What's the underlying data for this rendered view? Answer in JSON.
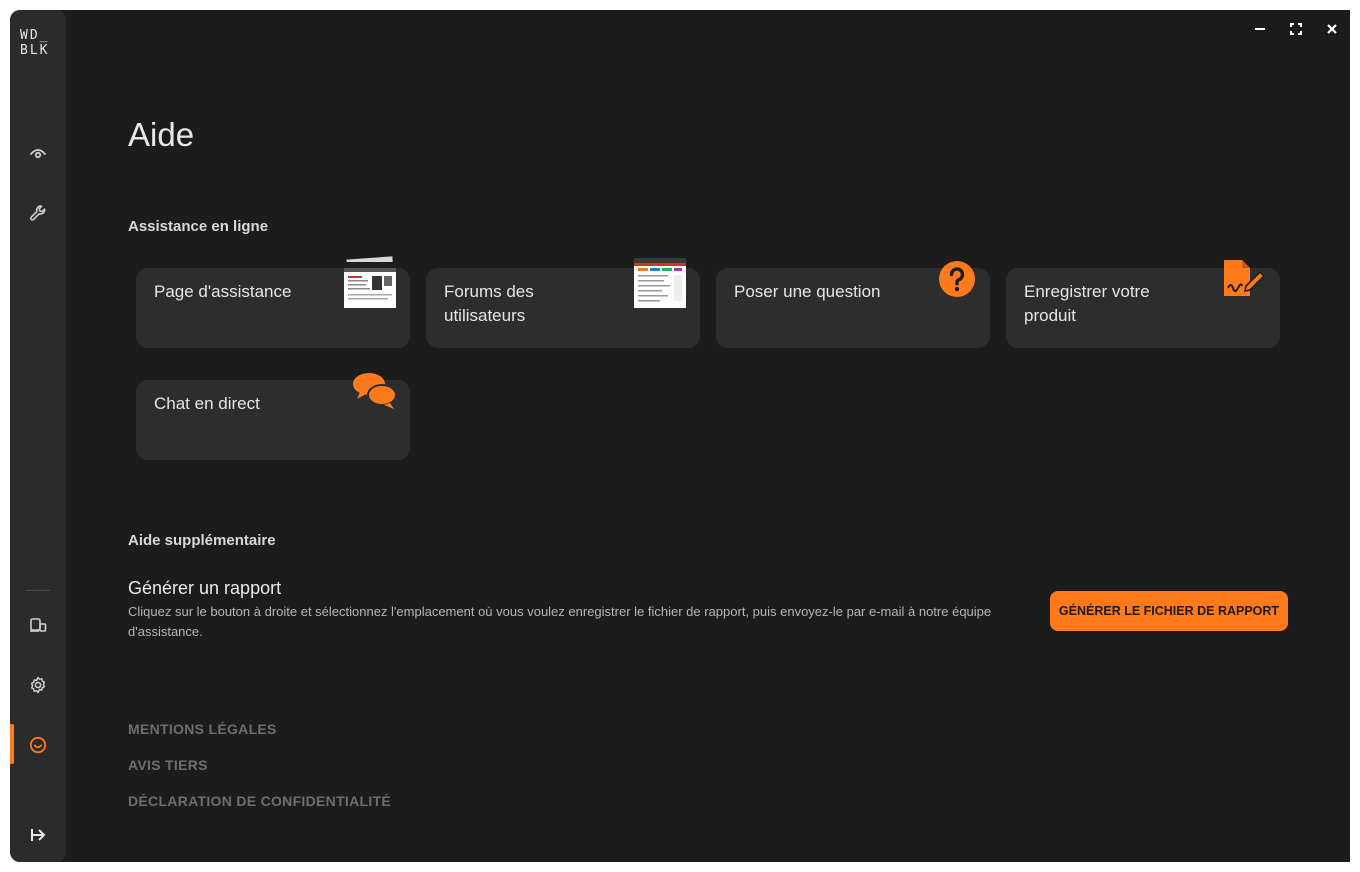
{
  "app": {
    "logo_line1": "WD_",
    "logo_line2": "BLK"
  },
  "colors": {
    "accent": "#ff7a1a",
    "background": "#1c1c1c",
    "sidebar": "#2b2b2b",
    "card": "#2d2d2d"
  },
  "sidebar": {
    "items": [
      {
        "name": "dashboard",
        "icon": "eye-icon"
      },
      {
        "name": "tools",
        "icon": "wrench-icon"
      },
      {
        "name": "devices",
        "icon": "devices-icon"
      },
      {
        "name": "settings",
        "icon": "gear-icon"
      },
      {
        "name": "help",
        "icon": "smile-icon",
        "active": true
      },
      {
        "name": "exit",
        "icon": "exit-icon"
      }
    ]
  },
  "page": {
    "title": "Aide"
  },
  "online_support": {
    "heading": "Assistance en ligne",
    "cards": [
      {
        "label": "Page d'assistance",
        "icon": "web-page-thumbnail"
      },
      {
        "label": "Forums des utilisateurs",
        "icon": "forum-thumbnail"
      },
      {
        "label": "Poser une question",
        "icon": "question-circle-icon"
      },
      {
        "label": "Enregistrer votre produit",
        "icon": "register-document-icon"
      },
      {
        "label": "Chat en direct",
        "icon": "chat-bubbles-icon"
      }
    ]
  },
  "additional_help": {
    "heading": "Aide supplémentaire",
    "report_title": "Générer un rapport",
    "report_description": "Cliquez sur le bouton à droite et sélectionnez l'emplacement où vous voulez enregistrer le fichier de rapport, puis envoyez-le par e-mail à notre équipe d'assistance.",
    "report_button": "GÉNÉRER LE FICHIER DE RAPPORT"
  },
  "footer": {
    "links": [
      "MENTIONS LÉGALES",
      "AVIS TIERS",
      "DÉCLARATION DE CONFIDENTIALITÉ"
    ]
  }
}
